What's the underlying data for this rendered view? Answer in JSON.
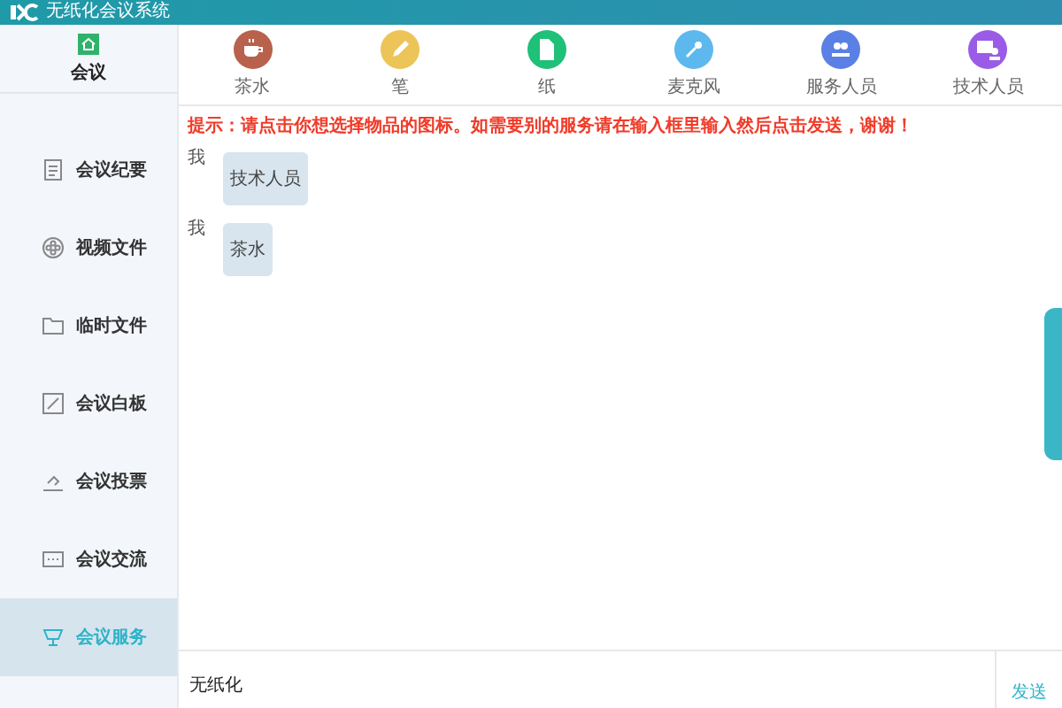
{
  "window": {
    "title": "无纸化会议系统"
  },
  "sidebar": {
    "home": {
      "label": "会议"
    },
    "items": [
      {
        "label": "会议纪要",
        "kind": "notes",
        "selected": false
      },
      {
        "label": "视频文件",
        "kind": "video",
        "selected": false
      },
      {
        "label": "临时文件",
        "kind": "folder",
        "selected": false
      },
      {
        "label": "会议白板",
        "kind": "board",
        "selected": false
      },
      {
        "label": "会议投票",
        "kind": "vote",
        "selected": false
      },
      {
        "label": "会议交流",
        "kind": "chat",
        "selected": false
      },
      {
        "label": "会议服务",
        "kind": "service",
        "selected": true
      }
    ]
  },
  "services": [
    {
      "label": "茶水",
      "kind": "cup",
      "color": "#b8614d"
    },
    {
      "label": "笔",
      "kind": "pen",
      "color": "#ecc457"
    },
    {
      "label": "纸",
      "kind": "paper",
      "color": "#1fc077"
    },
    {
      "label": "麦克风",
      "kind": "mic",
      "color": "#5db8ee"
    },
    {
      "label": "服务人员",
      "kind": "staff",
      "color": "#5a80e6"
    },
    {
      "label": "技术人员",
      "kind": "tech",
      "color": "#9a5ce6"
    }
  ],
  "hint": "提示：请点击你想选择物品的图标。如需要别的服务请在输入框里输入然后点击发送，谢谢！",
  "messages": [
    {
      "sender": "我",
      "text": "技术人员"
    },
    {
      "sender": "我",
      "text": "茶水"
    }
  ],
  "input": {
    "value": "无纸化"
  },
  "send_button": "发送"
}
